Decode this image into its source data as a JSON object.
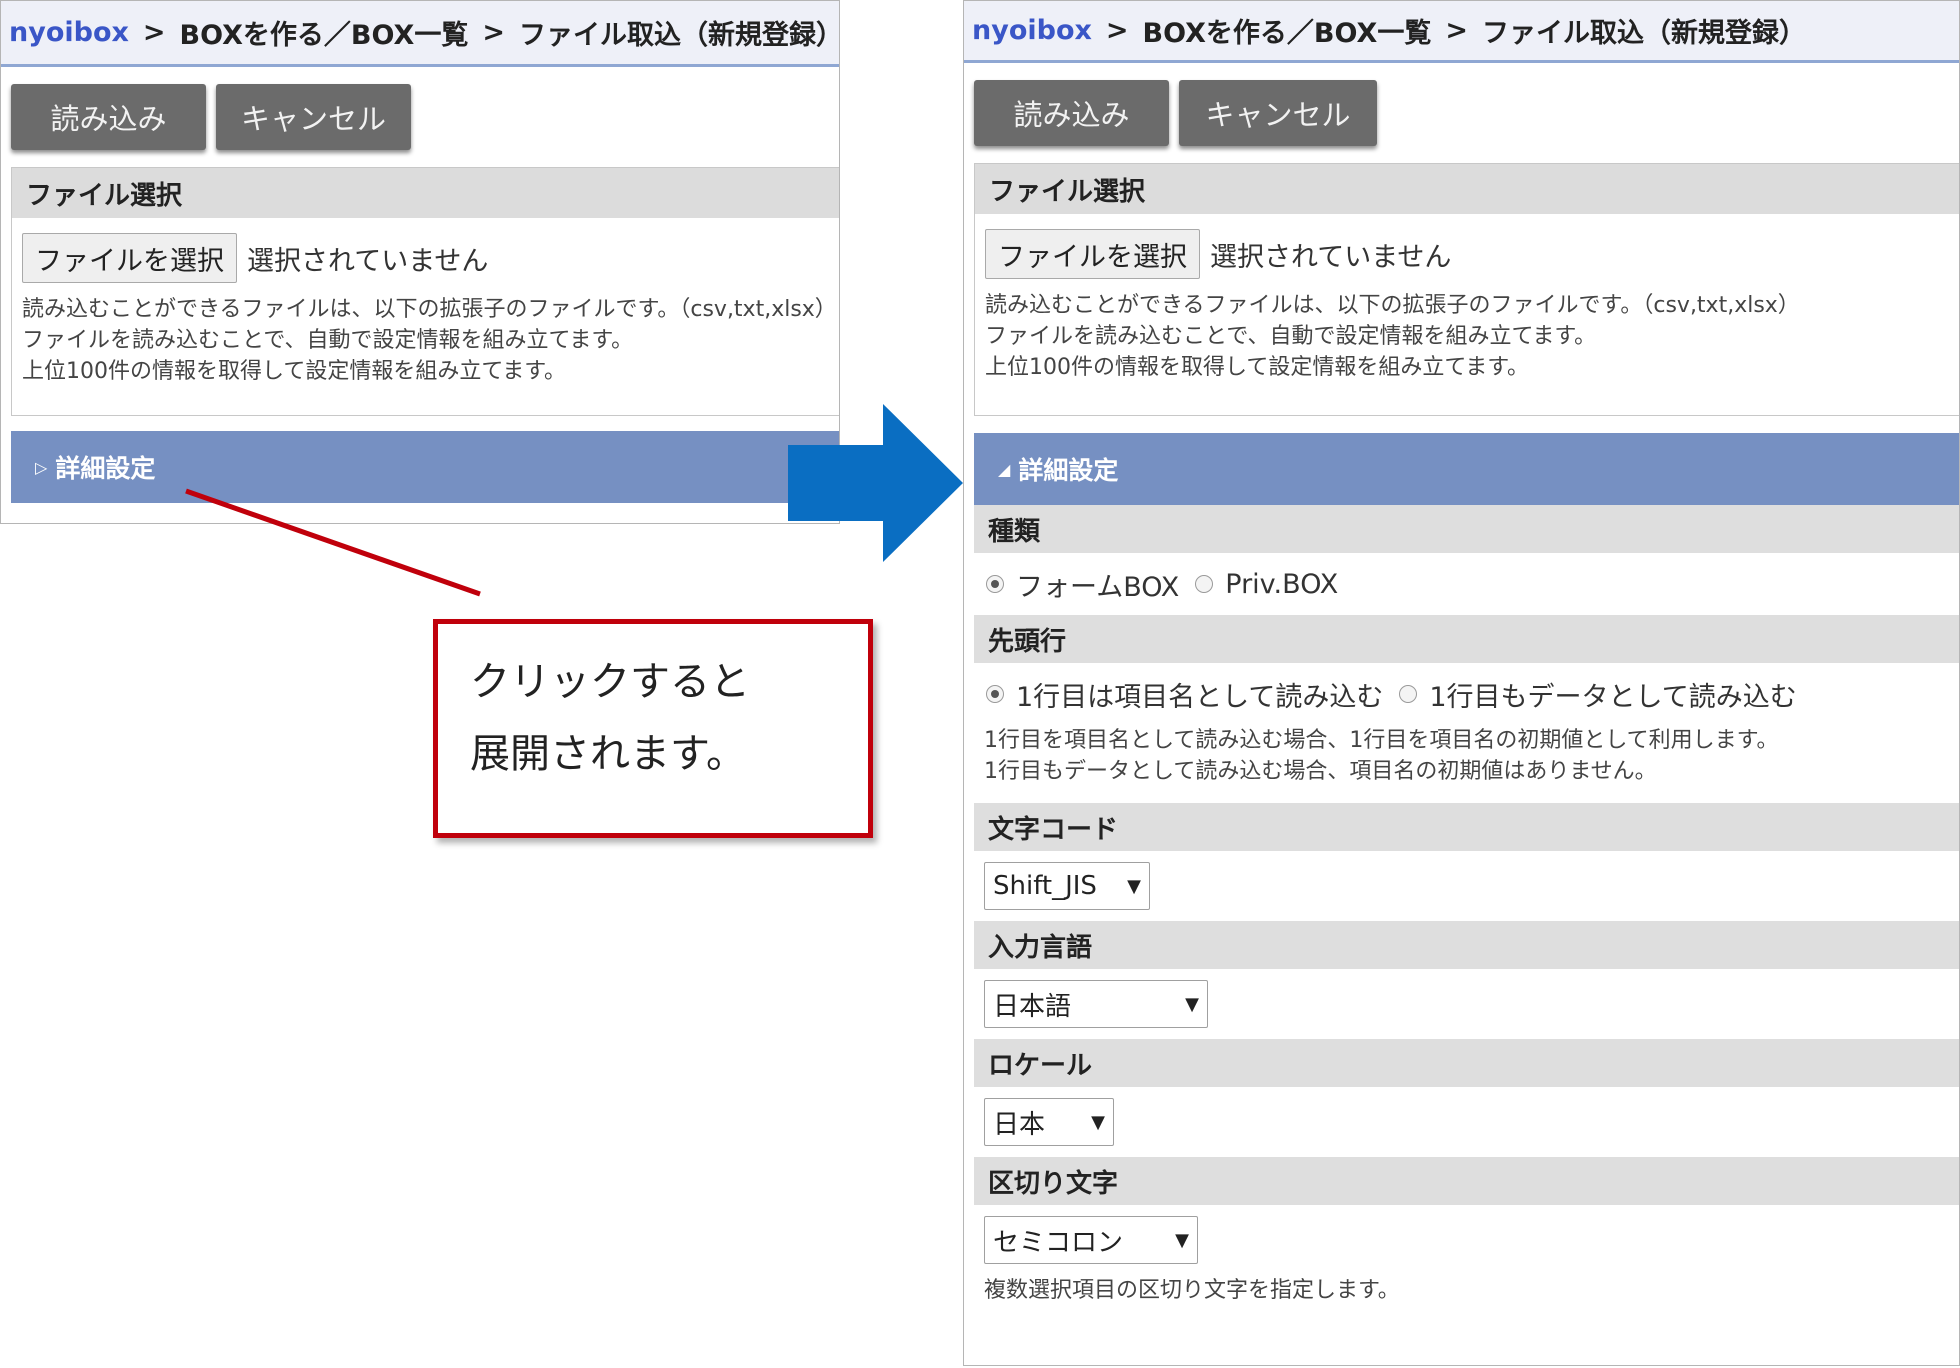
{
  "breadcrumb": {
    "home": "nyoibox",
    "sep1": ">",
    "item1": "BOXを作る／BOX一覧",
    "sep2": ">",
    "item2": "ファイル取込（新規登録）"
  },
  "buttons": {
    "load": "読み込み",
    "cancel": "キャンセル"
  },
  "file_section": {
    "title": "ファイル選択",
    "choose_button": "ファイルを選択",
    "status": "選択されていません",
    "desc1": "読み込むことができるファイルは、以下の拡張子のファイルです。（csv,txt,xlsx）",
    "desc2": "ファイルを読み込むことで、自動で設定情報を組み立てます。",
    "desc3": "上位100件の情報を取得して設定情報を組み立てます。"
  },
  "detail": {
    "label": "詳細設定",
    "caret_collapsed": "▷",
    "caret_expanded": "◢"
  },
  "fields": {
    "kind": {
      "label": "種類",
      "opt1": "フォームBOX",
      "opt2": "Priv.BOX",
      "selected": "フォームBOX"
    },
    "header_row": {
      "label": "先頭行",
      "opt1": "1行目は項目名として読み込む",
      "opt2": "1行目もデータとして読み込む",
      "selected": "1行目は項目名として読み込む",
      "note1": "1行目を項目名として読み込む場合、1行目を項目名の初期値として利用します。",
      "note2": "1行目もデータとして読み込む場合、項目名の初期値はありません。"
    },
    "charset": {
      "label": "文字コード",
      "value": "Shift_JIS"
    },
    "language": {
      "label": "入力言語",
      "value": "日本語"
    },
    "locale": {
      "label": "ロケール",
      "value": "日本"
    },
    "delimiter": {
      "label": "区切り文字",
      "value": "セミコロン",
      "note": "複数選択項目の区切り文字を指定します。"
    }
  },
  "annotation": {
    "line1": "クリックすると",
    "line2": "展開されます。"
  },
  "icons": {
    "arrow": "right-arrow-icon",
    "select": "chevron-down-icon",
    "caret": "triangle-icon"
  },
  "colors": {
    "detail_bar": "#7690c2",
    "arrow": "#0a6ec2",
    "callout_border": "#c0000b",
    "breadcrumb_link": "#3a56c7"
  }
}
